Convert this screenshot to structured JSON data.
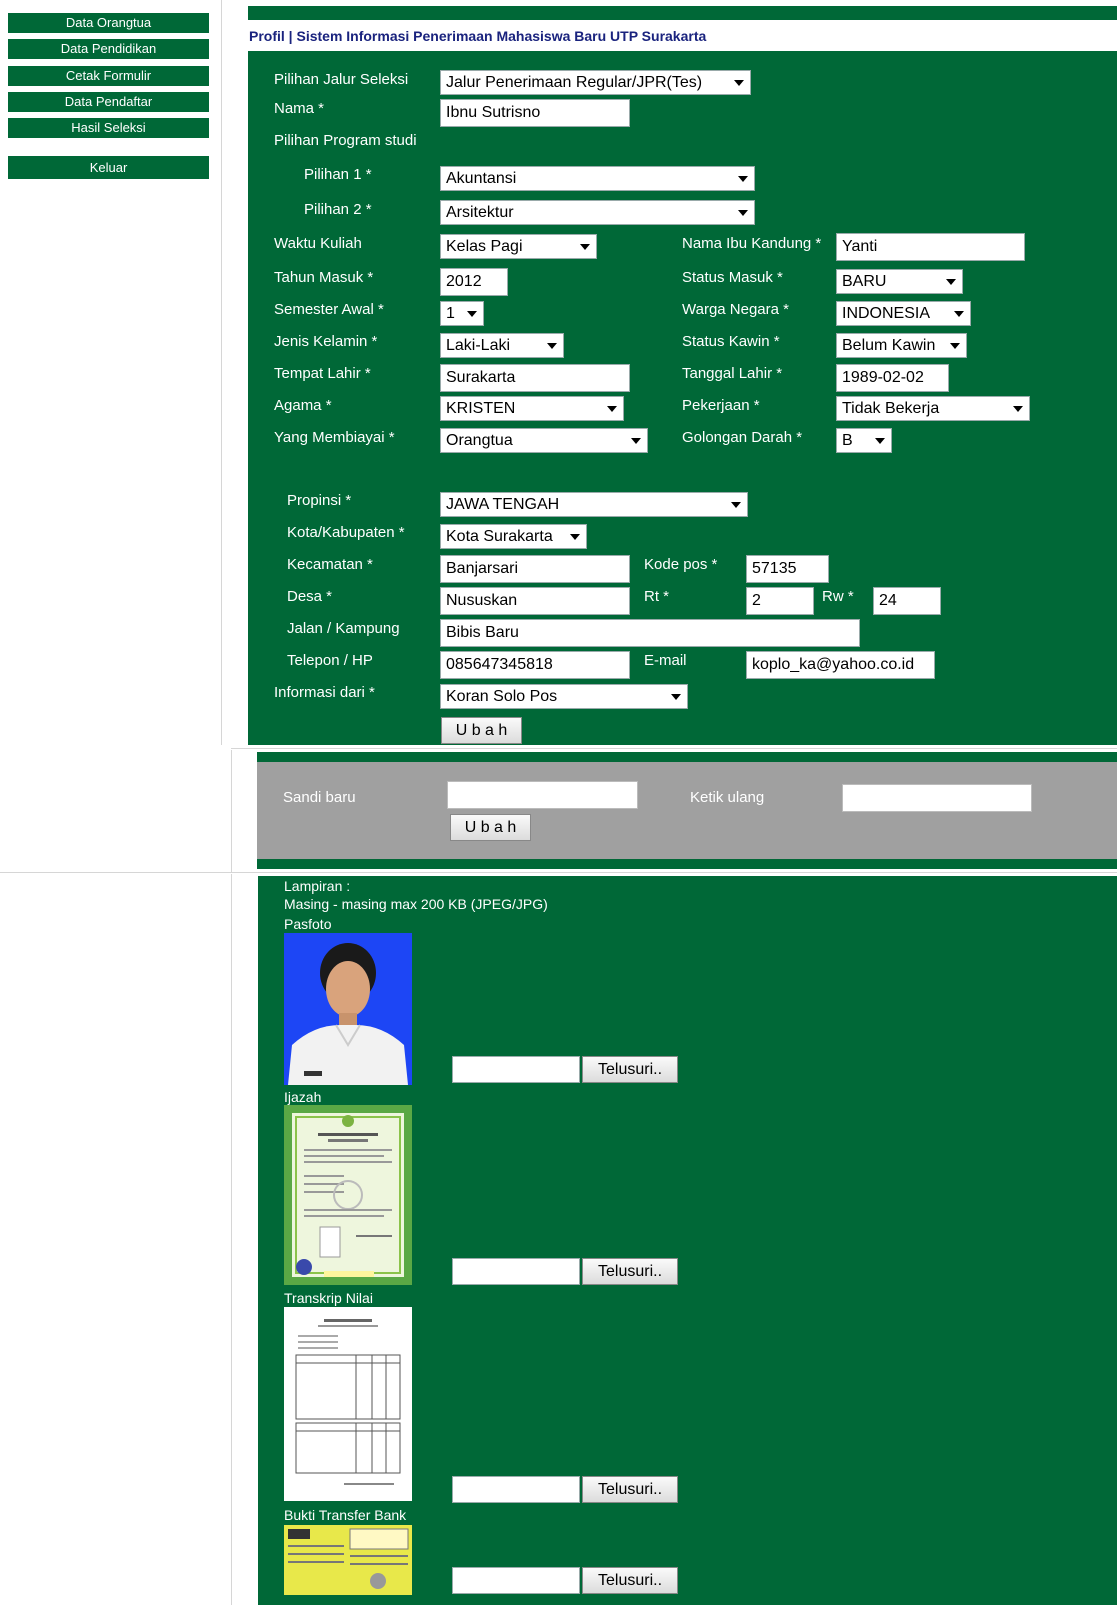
{
  "sidebar": {
    "items": [
      "Data Orangtua",
      "Data Pendidikan",
      "Cetak Formulir",
      "Data Pendaftar",
      "Hasil Seleksi"
    ],
    "logout": "Keluar"
  },
  "header": {
    "title": "Profil | Sistem Informasi Penerimaan Mahasiswa Baru UTP Surakarta"
  },
  "form": {
    "jalur_label": "Pilihan Jalur Seleksi",
    "jalur_value": "Jalur Penerimaan Regular/JPR(Tes)",
    "nama_label": "Nama *",
    "nama_value": "Ibnu Sutrisno",
    "prodi_label": "Pilihan Program studi",
    "pilihan1_label": "Pilihan 1 *",
    "pilihan1_value": "Akuntansi",
    "pilihan2_label": "Pilihan 2 *",
    "pilihan2_value": "Arsitektur",
    "waktu_label": "Waktu Kuliah",
    "waktu_value": "Kelas Pagi",
    "ibu_label": "Nama Ibu Kandung *",
    "ibu_value": "Yanti",
    "tahun_label": "Tahun Masuk *",
    "tahun_value": "2012",
    "status_masuk_label": "Status Masuk *",
    "status_masuk_value": "BARU",
    "semester_label": "Semester Awal *",
    "semester_value": "1",
    "warga_label": "Warga Negara *",
    "warga_value": "INDONESIA",
    "jk_label": "Jenis Kelamin *",
    "jk_value": "Laki-Laki",
    "kawin_label": "Status Kawin *",
    "kawin_value": "Belum Kawin",
    "tempat_label": "Tempat Lahir *",
    "tempat_value": "Surakarta",
    "tanggal_label": "Tanggal Lahir *",
    "tanggal_value": "1989-02-02",
    "agama_label": "Agama *",
    "agama_value": "KRISTEN",
    "pekerjaan_label": "Pekerjaan *",
    "pekerjaan_value": "Tidak Bekerja",
    "biaya_label": "Yang Membiayai *",
    "biaya_value": "Orangtua",
    "darah_label": "Golongan Darah *",
    "darah_value": "B",
    "propinsi_label": "Propinsi *",
    "propinsi_value": "JAWA TENGAH",
    "kota_label": "Kota/Kabupaten *",
    "kota_value": "Kota Surakarta",
    "kecamatan_label": "Kecamatan *",
    "kecamatan_value": "Banjarsari",
    "kodepos_label": "Kode pos *",
    "kodepos_value": "57135",
    "desa_label": "Desa *",
    "desa_value": "Nususkan",
    "rt_label": "Rt *",
    "rt_value": "2",
    "rw_label": "Rw *",
    "rw_value": "24",
    "jalan_label": "Jalan / Kampung",
    "jalan_value": "Bibis Baru",
    "telepon_label": "Telepon / HP",
    "telepon_value": "085647345818",
    "email_label": "E-mail",
    "email_value": "koplo_ka@yahoo.co.id",
    "info_label": "Informasi dari *",
    "info_value": "Koran Solo Pos",
    "submit_label": "U b a h"
  },
  "password": {
    "new_label": "Sandi baru",
    "retype_label": "Ketik ulang",
    "submit_label": "U b a h"
  },
  "attachments": {
    "title": "Lampiran :",
    "note": "Masing - masing max 200 KB (JPEG/JPG)",
    "browse_label": "Telusuri..",
    "items": [
      "Pasfoto",
      "Ijazah",
      "Transkrip Nilai",
      "Bukti Transfer Bank"
    ]
  },
  "colors": {
    "panel_green": "#006837",
    "panel_gray": "#a0a0a0",
    "title_blue": "#1a237e"
  }
}
